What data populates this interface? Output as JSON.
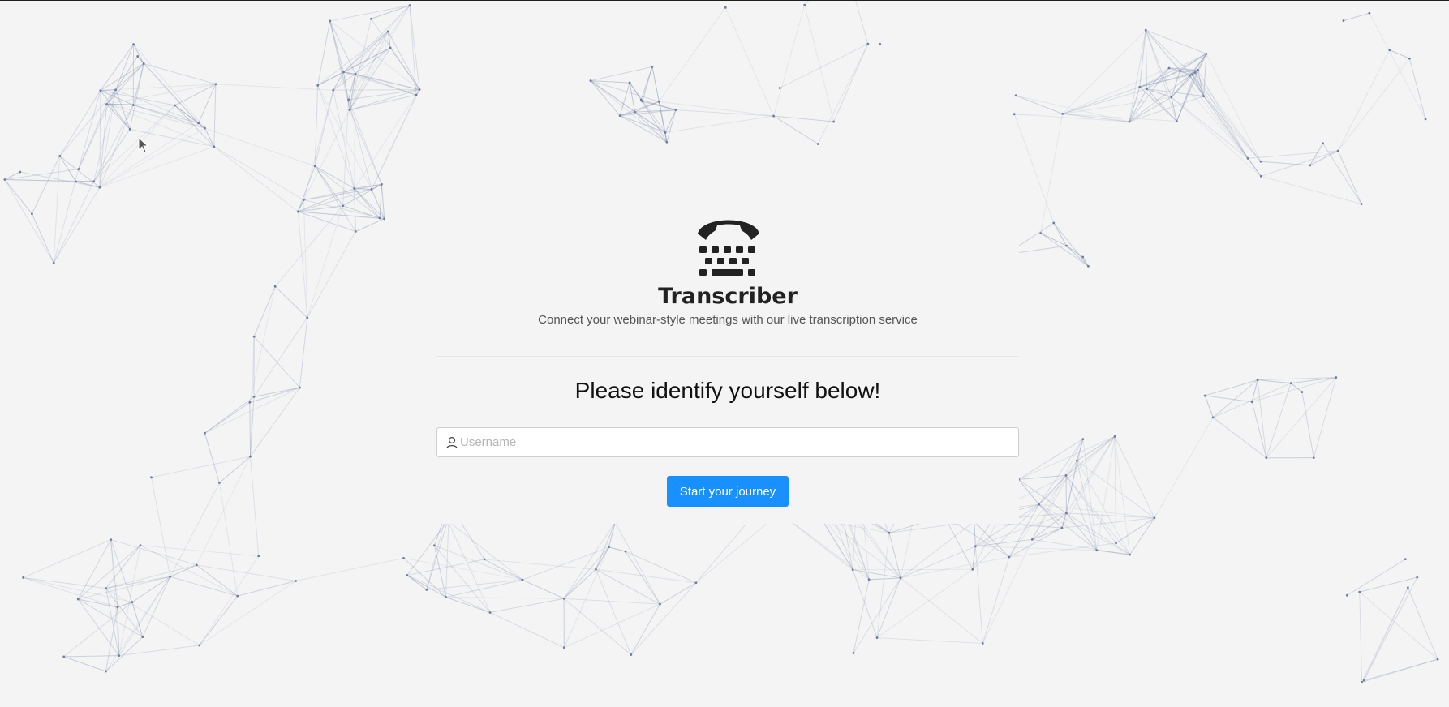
{
  "app": {
    "title": "Transcriber",
    "subtitle": "Connect your webinar-style meetings with our live transcription service",
    "icon": "phone-keyboard-icon"
  },
  "login": {
    "heading": "Please identify yourself below!",
    "username_placeholder": "Username",
    "username_value": "",
    "username_icon": "user-icon",
    "submit_label": "Start your journey"
  },
  "colors": {
    "background": "#f4f4f4",
    "accent": "#1890ff",
    "network_lines": "#8d9ab8"
  }
}
